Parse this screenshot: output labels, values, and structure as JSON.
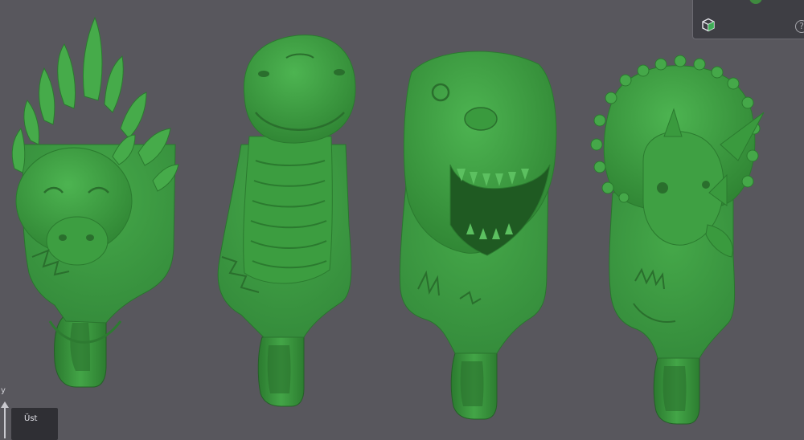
{
  "viewport": {
    "background": "#58575d",
    "model_color": "#3f9a43",
    "models": [
      {
        "name": "stegosaurus-hook"
      },
      {
        "name": "long-neck-dinosaur-hook"
      },
      {
        "name": "t-rex-hook"
      },
      {
        "name": "triceratops-hook"
      }
    ]
  },
  "navigation": {
    "cube_icon": "cube-icon",
    "help_icon": "help-icon",
    "help_symbol": "?"
  },
  "axis": {
    "y_label": "y",
    "view_label": "Üst"
  }
}
